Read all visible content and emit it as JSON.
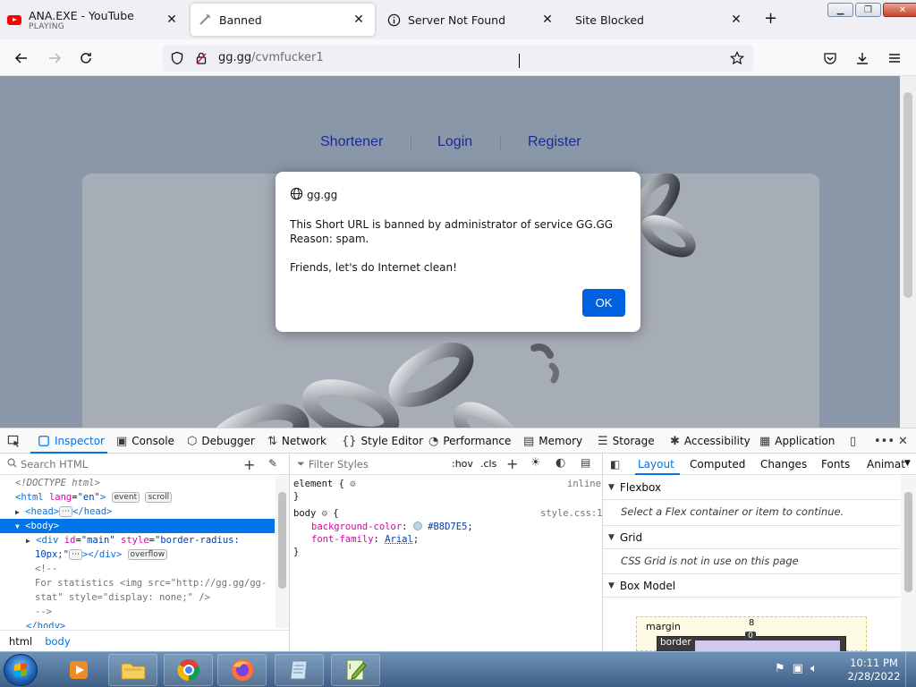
{
  "tabs": [
    {
      "title": "ANA.EXE - YouTube",
      "subtitle": "PLAYING",
      "close": "✕"
    },
    {
      "title": "Banned",
      "close": "✕"
    },
    {
      "title": "Server Not Found",
      "close": "✕"
    },
    {
      "title": "Site Blocked",
      "close": "✕"
    }
  ],
  "new_tab": "+",
  "url": {
    "host": "gg.gg",
    "path": "/cvmfucker1"
  },
  "page": {
    "menu": [
      "Shortener",
      "Login",
      "Register"
    ],
    "background_color": "#8A97A8"
  },
  "dialog": {
    "origin": "gg.gg",
    "lines": [
      "This Short URL is banned by administrator of service GG.GG",
      "Reason: spam.",
      "",
      "Friends, let's do Internet clean!"
    ],
    "ok": "OK"
  },
  "devtools": {
    "tabs": [
      "Inspector",
      "Console",
      "Debugger",
      "Network",
      "Style Editor",
      "Performance",
      "Memory",
      "Storage",
      "Accessibility",
      "Application"
    ],
    "search_placeholder": "Search HTML",
    "filter_placeholder": "Filter Styles",
    "hov": ":hov",
    "cls": ".cls",
    "tree": {
      "doctype": "<!DOCTYPE html>",
      "html_open": "<html",
      "html_lang_attr": "lang",
      "html_lang_val": "\"en\"",
      "html_close": ">",
      "badge_event": "event",
      "badge_scroll": "scroll",
      "head": "<head>",
      "head_close": "</head>",
      "body": "<body>",
      "div_open": "<div",
      "div_id_attr": "id",
      "div_id_val": "\"main\"",
      "div_style_attr": "style",
      "div_style_val1": "\"border-radius:",
      "div_style_val2": "10px;\"",
      "div_close": "></div>",
      "badge_overflow": "overflow",
      "comment_open": "<!--",
      "comment_line1": "For statistics <img src=\"http://gg.gg/gg-",
      "comment_line2": "stat\" style=\"display: none;\" />",
      "comment_close": "-->",
      "body_close": "</body>"
    },
    "breadcrumbs": [
      "html",
      "body"
    ],
    "rules": {
      "element_sel": "element {",
      "element_src": "inline",
      "close": "}",
      "body_sel": "body",
      "body_open": "{",
      "body_src": "style.css:1",
      "prop1": "background-color",
      "val1": "#B8D7E5",
      "prop2": "font-family",
      "val2": "Arial"
    },
    "layout_tabs": [
      "Layout",
      "Computed",
      "Changes",
      "Fonts",
      "Animat"
    ],
    "sections": [
      {
        "title": "Flexbox",
        "body": "Select a Flex container or item to continue."
      },
      {
        "title": "Grid",
        "body": "CSS Grid is not in use on this page"
      },
      {
        "title": "Box Model",
        "body": ""
      }
    ],
    "boxmodel": {
      "margin": "margin",
      "border": "border",
      "top": "8",
      "border_top": "0"
    }
  },
  "taskbar": {
    "time": "10:11 PM",
    "date": "2/28/2022"
  },
  "colors": {
    "accent": "#0074E8",
    "ok_button": "#0061E0",
    "selected_row": "#0074E8"
  }
}
